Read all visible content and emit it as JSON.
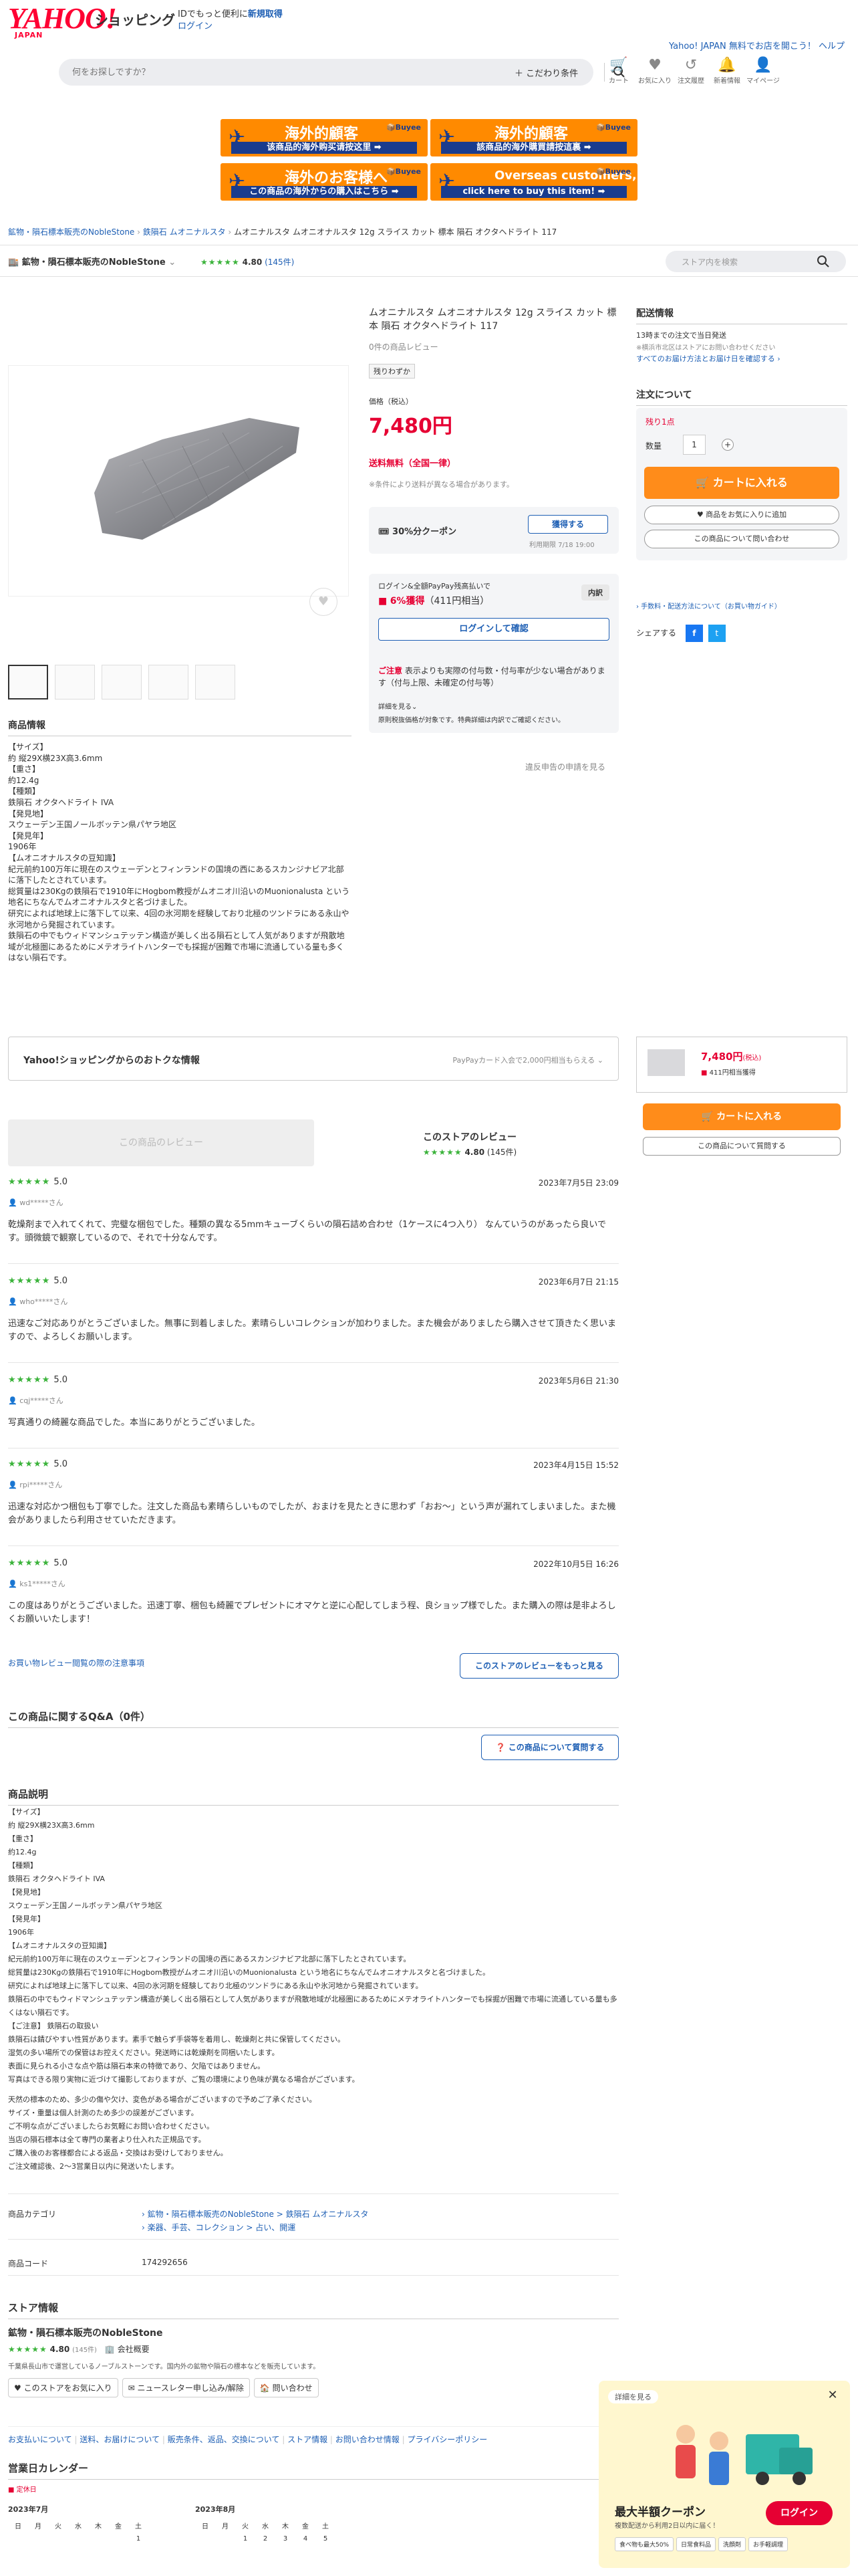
{
  "header": {
    "logo": "YAHOO!",
    "logo_sub": "JAPAN",
    "shopping": "ショッピング",
    "tagline_pre": "IDでもっと便利に",
    "tagline_link": "新規取得",
    "login": "ログイン",
    "top_links": "Yahoo! JAPAN  無料でお店を開こう！  ヘルプ",
    "search_placeholder": "何をお探しですか？",
    "kodawari": "＋ こだわり条件",
    "icons": [
      {
        "label": "カート",
        "icon": "cart-icon",
        "glyph": "🛒"
      },
      {
        "label": "お気に入り",
        "icon": "heart-icon",
        "glyph": "♥"
      },
      {
        "label": "注文履歴",
        "icon": "history-icon",
        "glyph": "↺"
      },
      {
        "label": "新着情報",
        "icon": "bell-icon",
        "glyph": "🔔"
      },
      {
        "label": "マイページ",
        "icon": "user-icon",
        "glyph": "👤"
      }
    ]
  },
  "banners": [
    {
      "t1": "海外的顧客",
      "t2": "该商品的海外购买请按这里 ➡",
      "bb": "📦Buyee"
    },
    {
      "t1": "海外的顧客",
      "t2": "該商品的海外購買請按這裏 ➡",
      "bb": "📦Buyee"
    },
    {
      "t1": "海外のお客様へ",
      "t2": "この商品の海外からの購入はこちら ➡",
      "bb": "📦Buyee"
    },
    {
      "t1": "Overseas customers,",
      "t2": "click here to buy this item! ➡",
      "bb": "📦Buyee"
    }
  ],
  "breadcrumb": [
    "鉱物・隕石標本販売のNobleStone",
    "鉄隕石 ムオニナルスタ"
  ],
  "breadcrumb_current": "ムオニナルスタ ムオニオナルスタ 12g スライス カット 標本 隕石 オクタヘドライト 117",
  "store": {
    "name": "鉱物・隕石標本販売のNobleStone",
    "rating": "4.80",
    "count": "(145件)",
    "search_placeholder": "ストア内を検索"
  },
  "product": {
    "title": "ムオニナルスタ ムオニオナルスタ 12g スライス カット 標本 隕石 オクタヘドライト 117",
    "reviews": "0件の商品レビュー",
    "stock_badge": "残りわずか",
    "price_label": "価格（税込）",
    "price": "7,480円",
    "shipping": "送料無料（全国一律）",
    "shipping_note": "※条件により送料が異なる場合があります。",
    "coupon": "30%分クーポン",
    "coupon_btn": "獲得する",
    "coupon_limit": "利用期限 7/18 19:00",
    "pp_title": "ログイン&全額PayPay残高払いで",
    "pp_badge": "内訳",
    "pp_rate": "6%獲得",
    "pp_amount": "（411円相当）",
    "pp_login": "ログインして確認",
    "caution_title": "ご注意",
    "caution": "表示よりも実際の付与数・付与率が少ない場合があります（付与上限、未確定の付与等）",
    "caution_more": "詳細を見る⌄",
    "caution_note": "原則税抜価格が対象です。特典詳細は内訳でご確認ください。",
    "report": "違反申告の申請を見る"
  },
  "delivery": {
    "title": "配送情報",
    "line1": "13時までの注文で当日発送",
    "line2": "※横浜市北区はストアにお問い合わせください",
    "line3": "すべてのお届け方法とお届け日を確認する ›",
    "order_title": "注文について",
    "stock": "残り1点",
    "qty_label": "数量",
    "qty": "1",
    "cart_btn": "カートに入れる",
    "fav_btn": "商品をお気に入りに追加",
    "ask_btn": "この商品について問い合わせ",
    "guide": "› 手数料・配送方法について（お買い物ガイド）",
    "share": "シェアする"
  },
  "info": {
    "title": "商品情報",
    "lines": [
      "【サイズ】",
      "約 縦29X横23X高3.6mm",
      "【重さ】",
      "約12.4g",
      "【種類】",
      "鉄隕石 オクタヘドライト IVA",
      "【発見地】",
      "スウェーデン王国ノールボッテン県パヤラ地区",
      "【発見年】",
      "1906年",
      "【ムオニオナルスタの豆知識】",
      "紀元前約100万年に現在のスウェーデンとフィンランドの国境の西にあるスカンジナビア北部に落下したとされています。",
      "総質量は230Kgの鉄隕石で1910年にHogbom教授がムオニオ川沿いのMuonionalusta という地名にちなんでムオニオナルスタと名づけました。",
      "研究によれば地球上に落下して以来、4回の氷河期を経験しており北極のツンドラにある永山や氷河地から発掘されています。",
      "鉄隕石の中でもウィドマンシュテッテン構造が美しく出る隕石として人気がありますが飛散地域が北極圏にあるためにメテオライトハンターでも採掘が困難で市場に流通している量も多くはない隕石です。"
    ]
  },
  "deals": {
    "title": "Yahoo!ショッピングからのおトクな情報",
    "right": "PayPayカード入会で2,000円相当もらえる ⌄"
  },
  "mini": {
    "price": "7,480円",
    "tax": "(税込)",
    "points": "411円相当獲得",
    "cart": "カートに入れる",
    "ask": "この商品について質問する"
  },
  "reviews_section": {
    "product_tab": "この商品のレビュー",
    "store_tab": "このストアのレビュー",
    "rating": "4.80",
    "count": "(145件)",
    "items": [
      {
        "score": "5.0",
        "date": "2023年7月5日 23:09",
        "user": "wd*****さん",
        "body": "乾燥剤まで入れてくれて、完璧な梱包でした。種類の異なる5mmキューブくらいの隕石詰め合わせ（1ケースに4つ入り） なんていうのがあったら良いです。頭微鏡で観察しているので、それで十分なんです。"
      },
      {
        "score": "5.0",
        "date": "2023年6月7日 21:15",
        "user": "who*****さん",
        "body": "迅速なご対応ありがとうございました。無事に到着しました。素晴らしいコレクションが加わりました。また機会がありましたら購入させて頂きたく思いますので、よろしくお願いします。"
      },
      {
        "score": "5.0",
        "date": "2023年5月6日 21:30",
        "user": "cqj*****さん",
        "body": "写真通りの綺麗な商品でした。本当にありがとうございました。"
      },
      {
        "score": "5.0",
        "date": "2023年4月15日 15:52",
        "user": "rpi*****さん",
        "body": "迅速な対応かつ梱包も丁寧でした。注文した商品も素晴らしいものでしたが、おまけを見たときに思わず「おお〜」という声が漏れてしまいました。また機会がありましたら利用させていただきます。"
      },
      {
        "score": "5.0",
        "date": "2022年10月5日 16:26",
        "user": "ks1*****さん",
        "body": "この度はありがとうございました。迅速丁寧、梱包も綺麗でプレゼントにオマケと逆に心配してしまう程、良ショップ様でした。また購入の際は是非よろしくお願いいたします！"
      }
    ],
    "guide_link": "お買い物レビュー閲覧の際の注意事項",
    "more_btn": "このストアのレビューをもっと見る"
  },
  "qa": {
    "title": "この商品に関するQ&A（0件）",
    "btn": "この商品について質問する"
  },
  "desc": {
    "title": "商品説明",
    "lines": [
      "【サイズ】",
      "約 縦29X横23X高3.6mm",
      "【重さ】",
      "約12.4g",
      "【種類】",
      "鉄隕石 オクタヘドライト IVA",
      "【発見地】",
      "スウェーデン王国ノールボッテン県パヤラ地区",
      "【発見年】",
      "1906年",
      "【ムオニオナルスタの豆知識】",
      "紀元前約100万年に現在のスウェーデンとフィンランドの国境の西にあるスカンジナビア北部に落下したとされています。",
      "総質量は230Kgの鉄隕石で1910年にHogbom教授がムオニオ川沿いのMuonionalusta という地名にちなんでムオニオナルスタと名づけました。",
      "研究によれば地球上に落下して以来、4回の氷河期を経験しており北極のツンドラにある永山や氷河地から発掘されています。",
      "鉄隕石の中でもウィドマンシュテッテン構造が美しく出る隕石として人気がありますが飛散地域が北極圏にあるためにメテオライトハンターでも採掘が困難で市場に流通している量も多くはない隕石です。",
      "【ご注意】 鉄隕石の取扱い",
      "鉄隕石は錆びやすい性質があります。素手で触らず手袋等を着用し、乾燥剤と共に保管してください。",
      "湿気の多い場所での保管はお控えください。発送時には乾燥剤を同梱いたします。",
      "表面に見られる小さな点や筋は隕石本来の特徴であり、欠陥ではありません。",
      "写真はできる限り実物に近づけて撮影しておりますが、ご覧の環境により色味が異なる場合がございます。"
    ],
    "lines2": [
      "天然の標本のため、多少の傷や欠け、変色がある場合がございますので予めご了承ください。",
      "サイズ・重量は個人計測のため多少の誤差がございます。",
      "ご不明な点がございましたらお気軽にお問い合わせください。",
      "当店の隕石標本は全て専門の業者より仕入れた正規品です。",
      "ご購入後のお客様都合による返品・交換はお受けしておりません。",
      "ご注文確認後、2〜3営業日以内に発送いたします。"
    ],
    "cat_label": "商品カテゴリ",
    "cat1": "› 鉱物・隕石標本販売のNobleStone > 鉄隕石 ムオニナルスタ",
    "cat2": "› 楽器、手芸、コレクション > 占い、開運",
    "code_label": "商品コード",
    "code": "174292656"
  },
  "storeinfo": {
    "title": "ストア情報",
    "name": "鉱物・隕石標本販売のNobleStone",
    "rating": "4.80",
    "count": "(145件)",
    "type": "会社概要",
    "desc": "千葉県長山市で運営しているノーブルストーンです。国内外の鉱物や隕石の標本などを販売しています。",
    "btns": [
      "♥ このストアをお気に入り",
      "✉ ニュースレター申し込み/解除",
      "🏠 問い合わせ"
    ],
    "links": [
      "お支払いについて",
      "送料、お届けについて",
      "販売条件、返品、交換について",
      "ストア情報",
      "お問い合わせ情報",
      "プライバシーポリシー"
    ]
  },
  "calendar": {
    "title": "営業日カレンダー",
    "legend": "定休日",
    "m1": "2023年7月",
    "m2": "2023年8月",
    "dow": [
      "日",
      "月",
      "火",
      "水",
      "木",
      "金",
      "土"
    ],
    "w1": [
      "",
      "",
      "",
      "",
      "",
      "",
      "1"
    ],
    "w2": [
      "",
      "",
      "1",
      "2",
      "3",
      "4",
      "5"
    ]
  },
  "popup": {
    "badge": "詳細を見る",
    "title": "最大半額クーポン",
    "sub": "複数配送から利用2日以内に届く！",
    "login": "ログイン",
    "tags": [
      "食べ物も最大50%",
      "日常食料品",
      "洗顔剤",
      "お手軽調理"
    ]
  }
}
